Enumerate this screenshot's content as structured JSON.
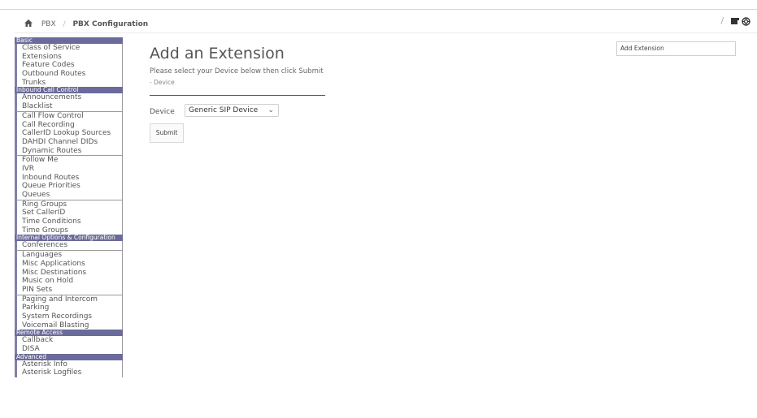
{
  "breadcrumb": {
    "home_icon": "home-icon",
    "items": [
      "PBX",
      "PBX Configuration"
    ],
    "separator": "/"
  },
  "toolbar": {
    "separator": "/",
    "icons": [
      "toggle-panel-icon",
      "help-lifebuoy-icon"
    ]
  },
  "sidebar": {
    "sections": [
      {
        "title": "Basic",
        "items": [
          "Class of Service",
          "Extensions",
          "Feature Codes",
          "Outbound Routes",
          "Trunks"
        ]
      },
      {
        "title": "Inbound Call Control",
        "items": [
          "Announcements",
          "Blacklist",
          "Call Flow Control",
          "Call Recording",
          "CallerID Lookup Sources",
          "DAHDI Channel DIDs",
          "Dynamic Routes",
          "Follow Me",
          "IVR",
          "Inbound Routes",
          "Queue Priorities",
          "Queues",
          "Ring Groups",
          "Set CallerID",
          "Time Conditions",
          "Time Groups"
        ]
      },
      {
        "title": "Internal Options & Configuration",
        "items": [
          "Conferences",
          "Languages",
          "Misc Applications",
          "Misc Destinations",
          "Music on Hold",
          "PIN Sets",
          "Paging and Intercom",
          "Parking",
          "System Recordings",
          "Voicemail Blasting"
        ]
      },
      {
        "title": "Remote Access",
        "items": [
          "Callback",
          "DISA"
        ]
      },
      {
        "title": "Advanced",
        "items": [
          "Asterisk Info",
          "Asterisk Logfiles"
        ]
      }
    ]
  },
  "main": {
    "title": "Add an Extension",
    "instruction": "Please select your Device below then click Submit",
    "section_label": "- Device",
    "device_label": "Device",
    "device_value": "Generic SIP Device",
    "submit_label": "Submit"
  },
  "right_panel": {
    "link_label": "Add Extension"
  },
  "colors": {
    "section_header_bg": "#6b6b9b",
    "nav_accent": "#8080aa"
  }
}
